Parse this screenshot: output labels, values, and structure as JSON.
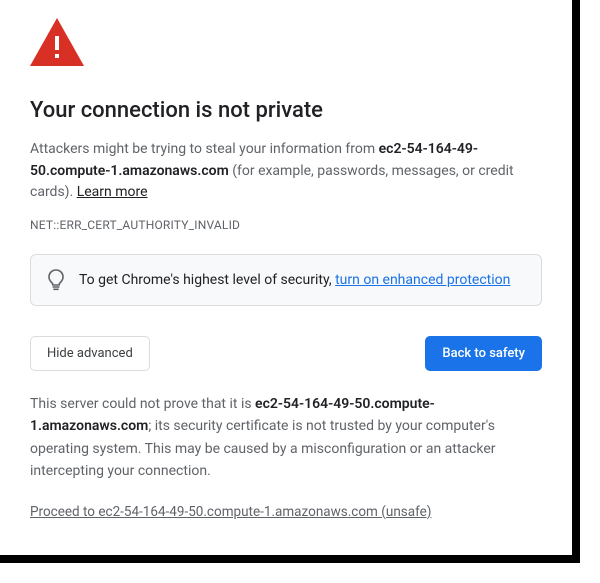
{
  "icon": "warning-triangle",
  "heading": "Your connection is not private",
  "host": "ec2-54-164-49-50.compute-1.amazonaws.com",
  "description": {
    "prefix": "Attackers might be trying to steal your information from ",
    "suffix": " (for example, passwords, messages, or credit cards). "
  },
  "learn_more": "Learn more",
  "error_code": "NET::ERR_CERT_AUTHORITY_INVALID",
  "promo": {
    "icon": "lightbulb",
    "text": "To get Chrome's highest level of security, ",
    "link_text": "turn on enhanced protection"
  },
  "buttons": {
    "hide_advanced": "Hide advanced",
    "back_to_safety": "Back to safety"
  },
  "advanced": {
    "p1_prefix": "This server could not prove that it is ",
    "p1_suffix": "; its security certificate is not trusted by your computer's operating system. This may be caused by a misconfiguration or an attacker intercepting your connection.",
    "proceed_prefix": "Proceed to ",
    "proceed_suffix": " (unsafe)"
  }
}
